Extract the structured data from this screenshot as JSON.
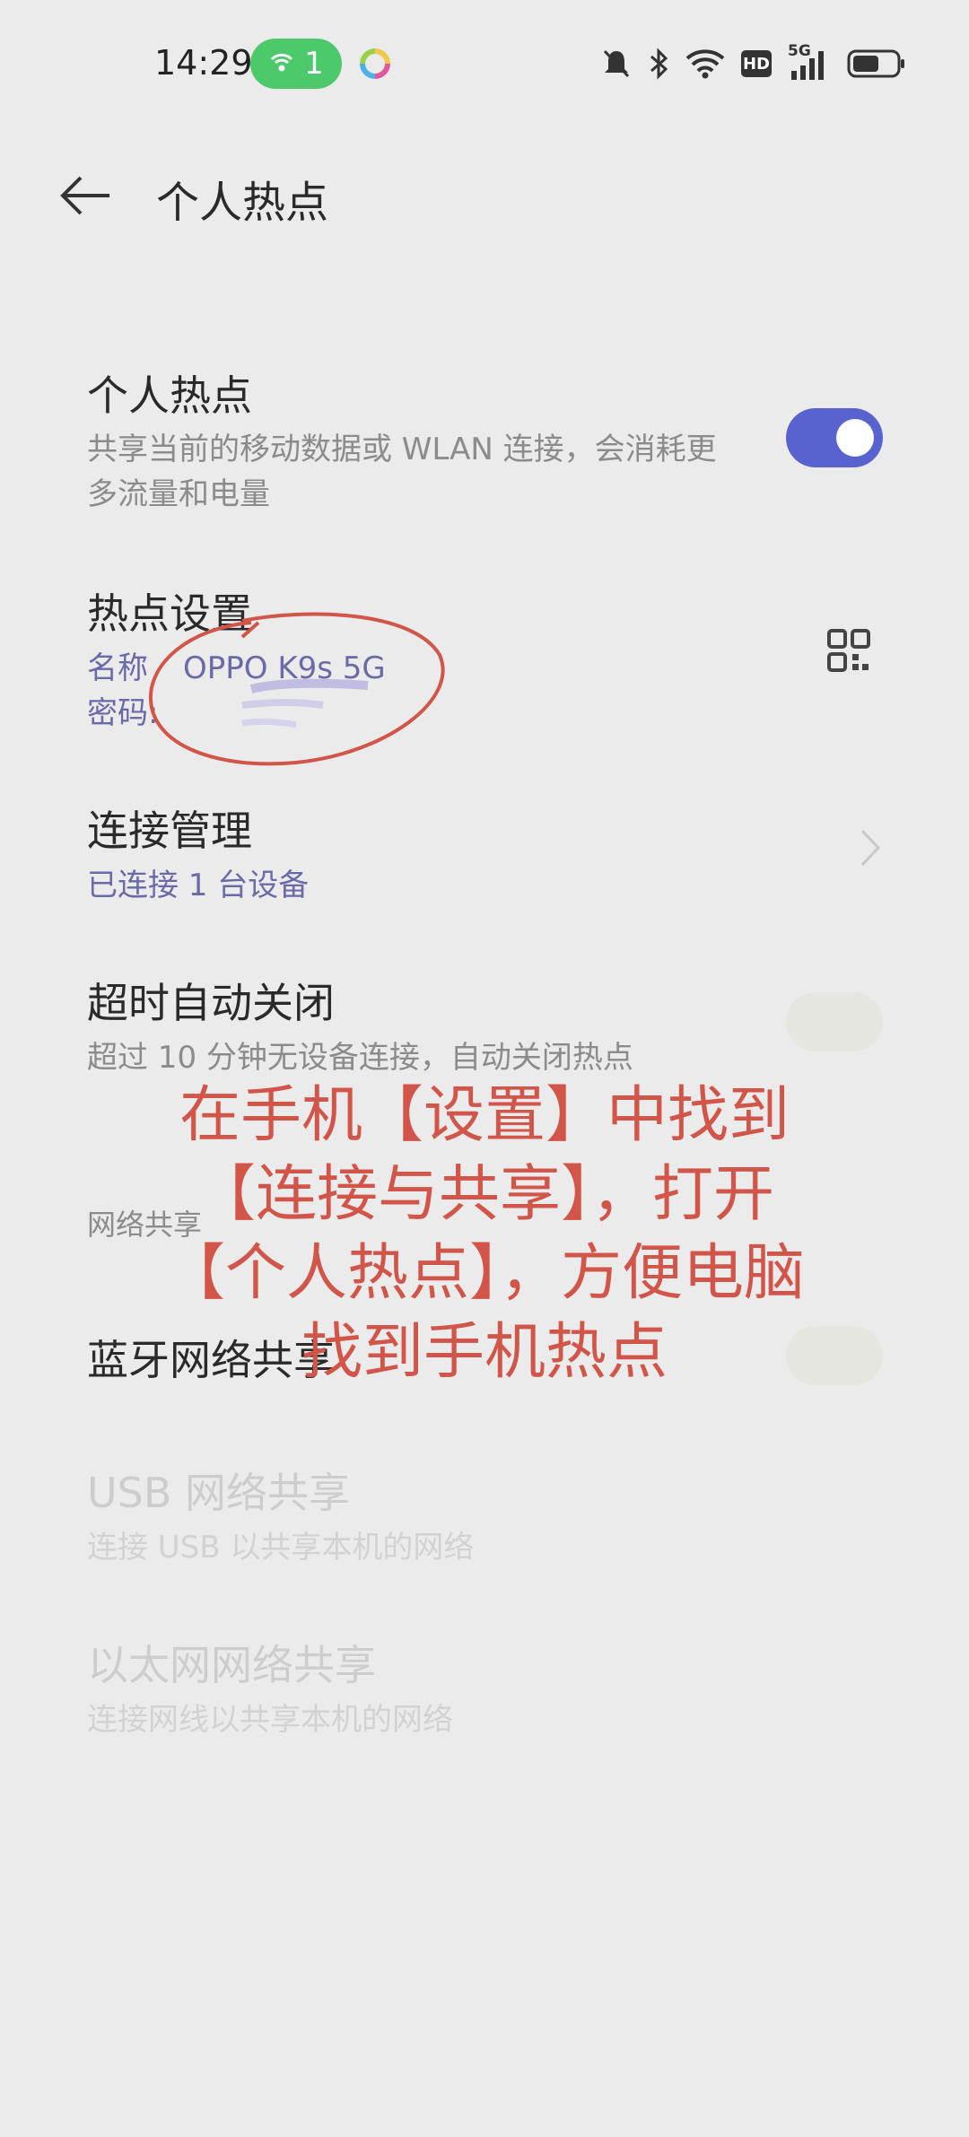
{
  "status_bar": {
    "time": "14:29",
    "hotspot_count": "1",
    "icons": [
      "mute-icon",
      "bluetooth-icon",
      "wifi-icon",
      "hd-icon",
      "5g-signal-icon",
      "battery-icon"
    ],
    "hd_label": "HD",
    "network_label": "5G"
  },
  "header": {
    "title": "个人热点",
    "back_icon": "back-arrow-icon"
  },
  "hotspot": {
    "title": "个人热点",
    "description_line1": "共享当前的移动数据或 WLAN 连接，会消耗更",
    "description_line2": "多流量和电量",
    "enabled": true
  },
  "hotspot_settings": {
    "title": "热点设置",
    "name_label": "名称",
    "name_value": "OPPO K9s 5G",
    "password_label": "密码:",
    "qr_icon": "qr-code-icon"
  },
  "connection_management": {
    "title": "连接管理",
    "subtitle": "已连接 1 台设备"
  },
  "auto_off": {
    "title": "超时自动关闭",
    "subtitle": "超过 10 分钟无设备连接，自动关闭热点"
  },
  "network_sharing": {
    "section_label": "网络共享",
    "bluetooth_title": "蓝牙网络共享",
    "usb_title": "USB 网络共享",
    "usb_subtitle": "连接 USB 以共享本机的网络",
    "ethernet_title": "以太网网络共享",
    "ethernet_subtitle": "连接网线以共享本机的网络"
  },
  "overlay": {
    "line1": "在手机【设置】中找到",
    "line2": "【连接与共享】，打开",
    "line3": "【个人热点】，方便电脑",
    "line4": "找到手机热点"
  },
  "colors": {
    "background": "#ebebeb",
    "toggle_on": "#5863cf",
    "accent_text": "#6a6aa8",
    "annotation_red": "#d2554a",
    "hotspot_pill": "#4cc96b"
  }
}
